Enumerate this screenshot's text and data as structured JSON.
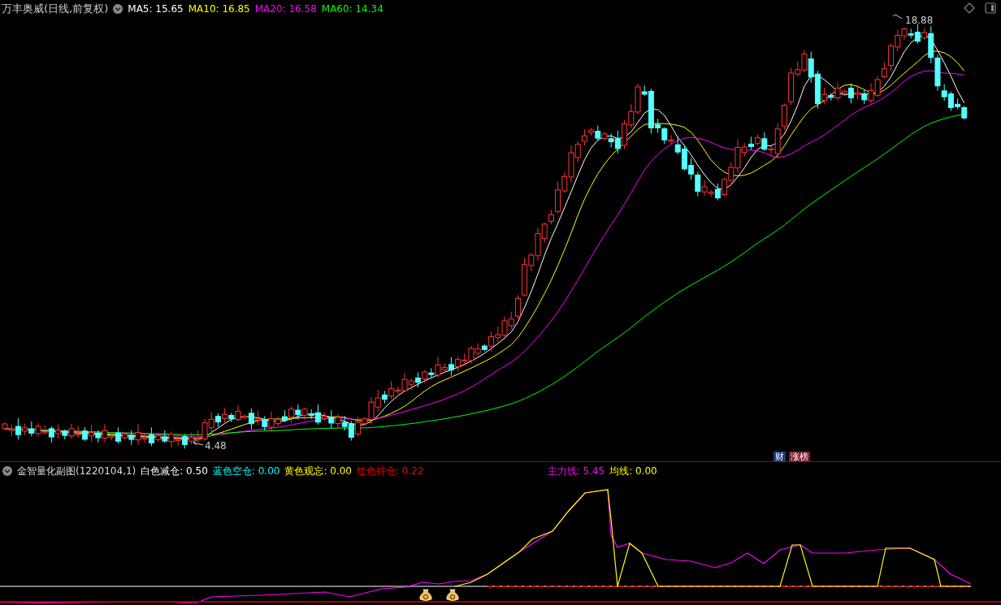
{
  "main_chart": {
    "title": "万丰奥威(日线,前复权)",
    "indicators": [
      {
        "label": "MA5:",
        "value": "15.65",
        "color": "#ffffff"
      },
      {
        "label": "MA10:",
        "value": "16.85",
        "color": "#ffff00"
      },
      {
        "label": "MA20:",
        "value": "16.58",
        "color": "#ff00ff"
      },
      {
        "label": "MA60:",
        "value": "14.34",
        "color": "#00ff00"
      }
    ],
    "high_label": "18.88",
    "low_label": "4.48",
    "badges": [
      {
        "text": "财",
        "kind": "info"
      },
      {
        "text": "涨榜",
        "kind": "rank"
      }
    ]
  },
  "sub_chart": {
    "title": "金智量化副图(1220104,1)",
    "legend": [
      {
        "label": "白色减仓:",
        "value": "0.50",
        "color": "#ffffff"
      },
      {
        "label": "蓝色空仓:",
        "value": "0.00",
        "color": "#00ffff"
      },
      {
        "label": "黄色观忘:",
        "value": "0.00",
        "color": "#ffff00"
      },
      {
        "label": "红色持仓:",
        "value": "0.22",
        "color": "#ff0000"
      }
    ],
    "lines": [
      {
        "label": "主力线:",
        "value": "5.45",
        "color": "#ff00ff"
      },
      {
        "label": "均线:",
        "value": "0.00",
        "color": "#ffff00"
      }
    ]
  }
}
